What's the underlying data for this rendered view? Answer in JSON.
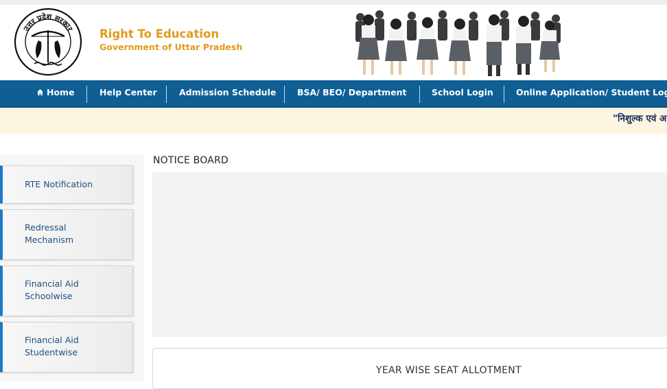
{
  "header": {
    "emblem_text": "उत्तर प्रदेश सरकार",
    "title": "Right To Education",
    "subtitle": "Government of Uttar Pradesh",
    "banner_icon": "students-running-image"
  },
  "nav": {
    "items": [
      {
        "label": "Home",
        "icon": "home-icon"
      },
      {
        "label": "Help Center"
      },
      {
        "label": "Admission Schedule"
      },
      {
        "label": "BSA/ BEO/ Department"
      },
      {
        "label": "School Login"
      },
      {
        "label": "Online Application/ Student Logi"
      }
    ]
  },
  "ticker": {
    "text": "\"निशुल्क एवं अ"
  },
  "sidebar": {
    "items": [
      {
        "line1": "RTE Notification",
        "line2": ""
      },
      {
        "line1": "Redressal",
        "line2": "Mechanism"
      },
      {
        "line1": "Financial Aid",
        "line2": "Schoolwise"
      },
      {
        "line1": "Financial Aid",
        "line2": "Studentwise"
      }
    ]
  },
  "notice_board": {
    "title": "NOTICE BOARD"
  },
  "seat_allotment": {
    "title": "YEAR WISE SEAT ALLOTMENT"
  },
  "colors": {
    "nav_bg": "#0f5f95",
    "brand": "#e19a1d",
    "ticker_bg": "#fcf5e2",
    "sidebar_accent": "#1d78c7"
  }
}
